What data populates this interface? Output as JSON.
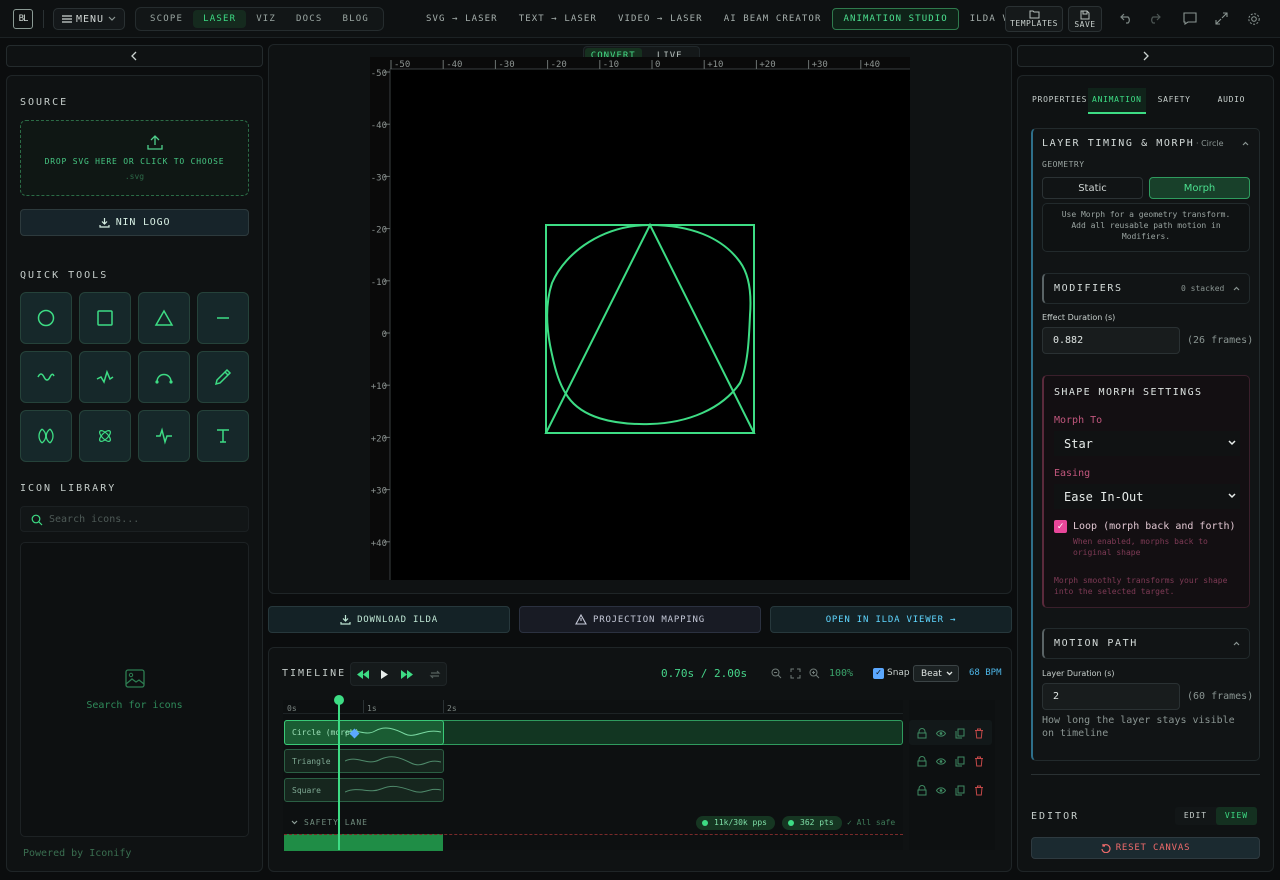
{
  "top": {
    "logo": "BL",
    "menu": "MENU",
    "modes": [
      "SCOPE",
      "LASER",
      "VIZ",
      "DOCS",
      "BLOG"
    ],
    "active_mode": "LASER",
    "nav": [
      "SVG → LASER",
      "TEXT → LASER",
      "VIDEO → LASER",
      "AI BEAM CREATOR",
      "ANIMATION STUDIO",
      "ILDA VIEWER"
    ],
    "active_nav": "ANIMATION STUDIO",
    "templates": "TEMPLATES",
    "save": "SAVE"
  },
  "left": {
    "source_title": "SOURCE",
    "drop_text": "DROP SVG HERE OR CLICK TO CHOOSE",
    "drop_ext": ".svg",
    "nin_button": "NIN LOGO",
    "quick_tools_title": "QUICK TOOLS",
    "tools": [
      "circle-icon",
      "square-icon",
      "triangle-icon",
      "line-icon",
      "wave-icon",
      "zigzag-icon",
      "arc-icon",
      "pencil-icon",
      "lissajous-icon",
      "spirograph-icon",
      "pulse-icon",
      "text-icon"
    ],
    "icon_library_title": "ICON LIBRARY",
    "search_placeholder": "Search icons...",
    "library_empty": "Search for icons",
    "powered_by": "Powered by Iconify"
  },
  "canvas": {
    "modes": [
      "CONVERT",
      "LIVE"
    ],
    "active_mode": "CONVERT",
    "x_ticks": [
      "-50",
      "-40",
      "-30",
      "-20",
      "-10",
      "0",
      "+10",
      "+20",
      "+30",
      "+40"
    ],
    "y_ticks": [
      "-50",
      "-40",
      "-30",
      "-20",
      "-10",
      "0",
      "+10",
      "+20",
      "+30",
      "+40"
    ],
    "beam_color": "#3ddc84",
    "actions": [
      "DOWNLOAD ILDA",
      "PROJECTION MAPPING",
      "OPEN IN ILDA VIEWER →"
    ]
  },
  "timeline": {
    "title": "TIMELINE",
    "time": "0.70s / 2.00s",
    "zoom": "100%",
    "snap_label": "Snap",
    "snap_checked": true,
    "beat_option": "Beat",
    "bpm": "68 BPM",
    "ruler": [
      "0s",
      "1s",
      "2s"
    ],
    "layers": [
      "Circle (morph)",
      "Triangle",
      "Square"
    ],
    "safety_lane": "SAFETY LANE",
    "pps": "11k/30k pps",
    "pts": "362 pts",
    "safe": "✓ All safe"
  },
  "right": {
    "tabs": [
      "PROPERTIES",
      "ANIMATION",
      "SAFETY",
      "AUDIO"
    ],
    "active_tab": "ANIMATION",
    "section_title": "LAYER TIMING & MORPH",
    "layer_name": "· Circle",
    "geometry_label": "GEOMETRY",
    "geometry_options": [
      "Static",
      "Morph"
    ],
    "geometry_active": "Morph",
    "geometry_hint": "Use Morph for a geometry transform. Add all reusable path motion in Modifiers.",
    "modifiers_title": "MODIFIERS",
    "modifiers_count": "0 stacked",
    "effect_duration_label": "Effect Duration (s)",
    "effect_duration": "0.882",
    "effect_frames": "(26 frames)",
    "morph_title": "SHAPE MORPH SETTINGS",
    "morph_to_label": "Morph To",
    "morph_to": "Star",
    "easing_label": "Easing",
    "easing": "Ease In-Out",
    "loop_label": "Loop (morph back and forth)",
    "loop_checked": true,
    "loop_hint": "When enabled, morphs back to original shape",
    "morph_hint": "Morph smoothly transforms your shape into the selected target.",
    "motion_path_title": "MOTION PATH",
    "layer_duration_label": "Layer Duration (s)",
    "layer_duration": "2",
    "layer_frames": "(60 frames)",
    "layer_duration_hint": "How long the layer stays visible on timeline",
    "editor_title": "EDITOR",
    "editor_modes": [
      "EDIT",
      "VIEW"
    ],
    "editor_active": "VIEW",
    "reset": "RESET CANVAS"
  }
}
